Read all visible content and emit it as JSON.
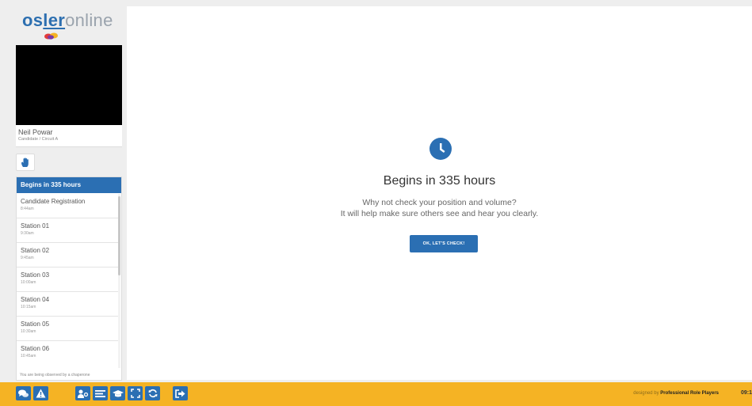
{
  "logo": {
    "part1": "os",
    "part2": "ler",
    "part3": "online"
  },
  "user": {
    "name": "Neil Powar",
    "role": "Candidate / Circuit A"
  },
  "schedule": {
    "header": "Begins in 335 hours",
    "items": [
      {
        "title": "Candidate Registration",
        "time": "8:44am"
      },
      {
        "title": "Station 01",
        "time": "9:30am"
      },
      {
        "title": "Station 02",
        "time": "9:45am"
      },
      {
        "title": "Station 03",
        "time": "10:00am"
      },
      {
        "title": "Station 04",
        "time": "10:15am"
      },
      {
        "title": "Station 05",
        "time": "10:30am"
      },
      {
        "title": "Station 06",
        "time": "10:45am"
      }
    ],
    "chaperone_note": "You are being observed by a chaperone"
  },
  "main": {
    "title": "Begins in 335 hours",
    "line1": "Why not check your position and volume?",
    "line2": "It will help make sure others see and hear you clearly.",
    "button_label": "OK, LET'S CHECK!"
  },
  "footer": {
    "designed_prefix": "designed by ",
    "designed_brand": "Professional Role Players",
    "clock": "09:1"
  },
  "colors": {
    "primary": "#2b6fb3",
    "footer": "#f5b324"
  },
  "icons": [
    "chat-icon",
    "warning-icon",
    "people-icon",
    "list-icon",
    "graduation-cap-icon",
    "fullscreen-icon",
    "refresh-icon",
    "exit-icon",
    "hand-icon",
    "clock-icon"
  ]
}
